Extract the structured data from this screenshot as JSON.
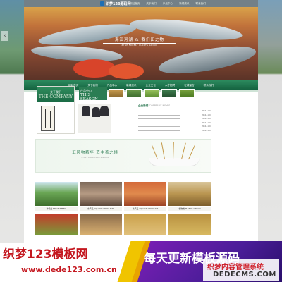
{
  "site": {
    "logo_text": "织梦123源码网",
    "top_nav": [
      "网站首页",
      "关于我们",
      "产品中心",
      "新闻资讯",
      "联系我们"
    ]
  },
  "hero": {
    "slogan": "海江河湖 & 我们田之物",
    "slogan_en": "ZYNE FOREST PLANTS GROUP"
  },
  "main_nav": [
    "网站首页",
    "关于我们",
    "产品中心",
    "新闻资讯",
    "企业文化",
    "人才招聘",
    "在线留言",
    "联系我们"
  ],
  "about": {
    "title_zh": "关于我们",
    "title_en": "THE COMPANY"
  },
  "products": {
    "title_zh": "产品中心",
    "title_en": "THIS SEASON"
  },
  "news": {
    "title": "企业新闻",
    "title_en": "COMPANY NEWS",
    "dates": [
      "2016-11-03",
      "2016-11-03",
      "2016-11-03",
      "2016-11-03",
      "2016-11-03",
      "2016-11-03"
    ]
  },
  "banner": {
    "slogan": "汇风物精华 造丰善之境",
    "slogan_en": "ZYNE FOREST PLANTS GROUP"
  },
  "grid": [
    {
      "caption": "种植业 THE FARMING"
    },
    {
      "caption": "水产品 AQUATIC PRODUCTS"
    },
    {
      "caption": "水产品 AQUATIC PRODUCT"
    },
    {
      "caption": "植物类 PLANTS GROUP"
    }
  ],
  "watermark": {
    "left_title": "织梦123模板网",
    "left_url": "www.dede123.com.cn",
    "right_title": "每天更新模板源码",
    "badge_title": "织梦内容管理系统",
    "badge_url": "DEDECMS.COM"
  },
  "colors": {
    "brand_green": "#1a6a44",
    "watermark_red": "#c4171f",
    "watermark_purple": "#6a1fb0",
    "watermark_yellow": "#f0c400"
  },
  "icons": [
    "logo-mark-icon",
    "chevron-left-icon"
  ]
}
